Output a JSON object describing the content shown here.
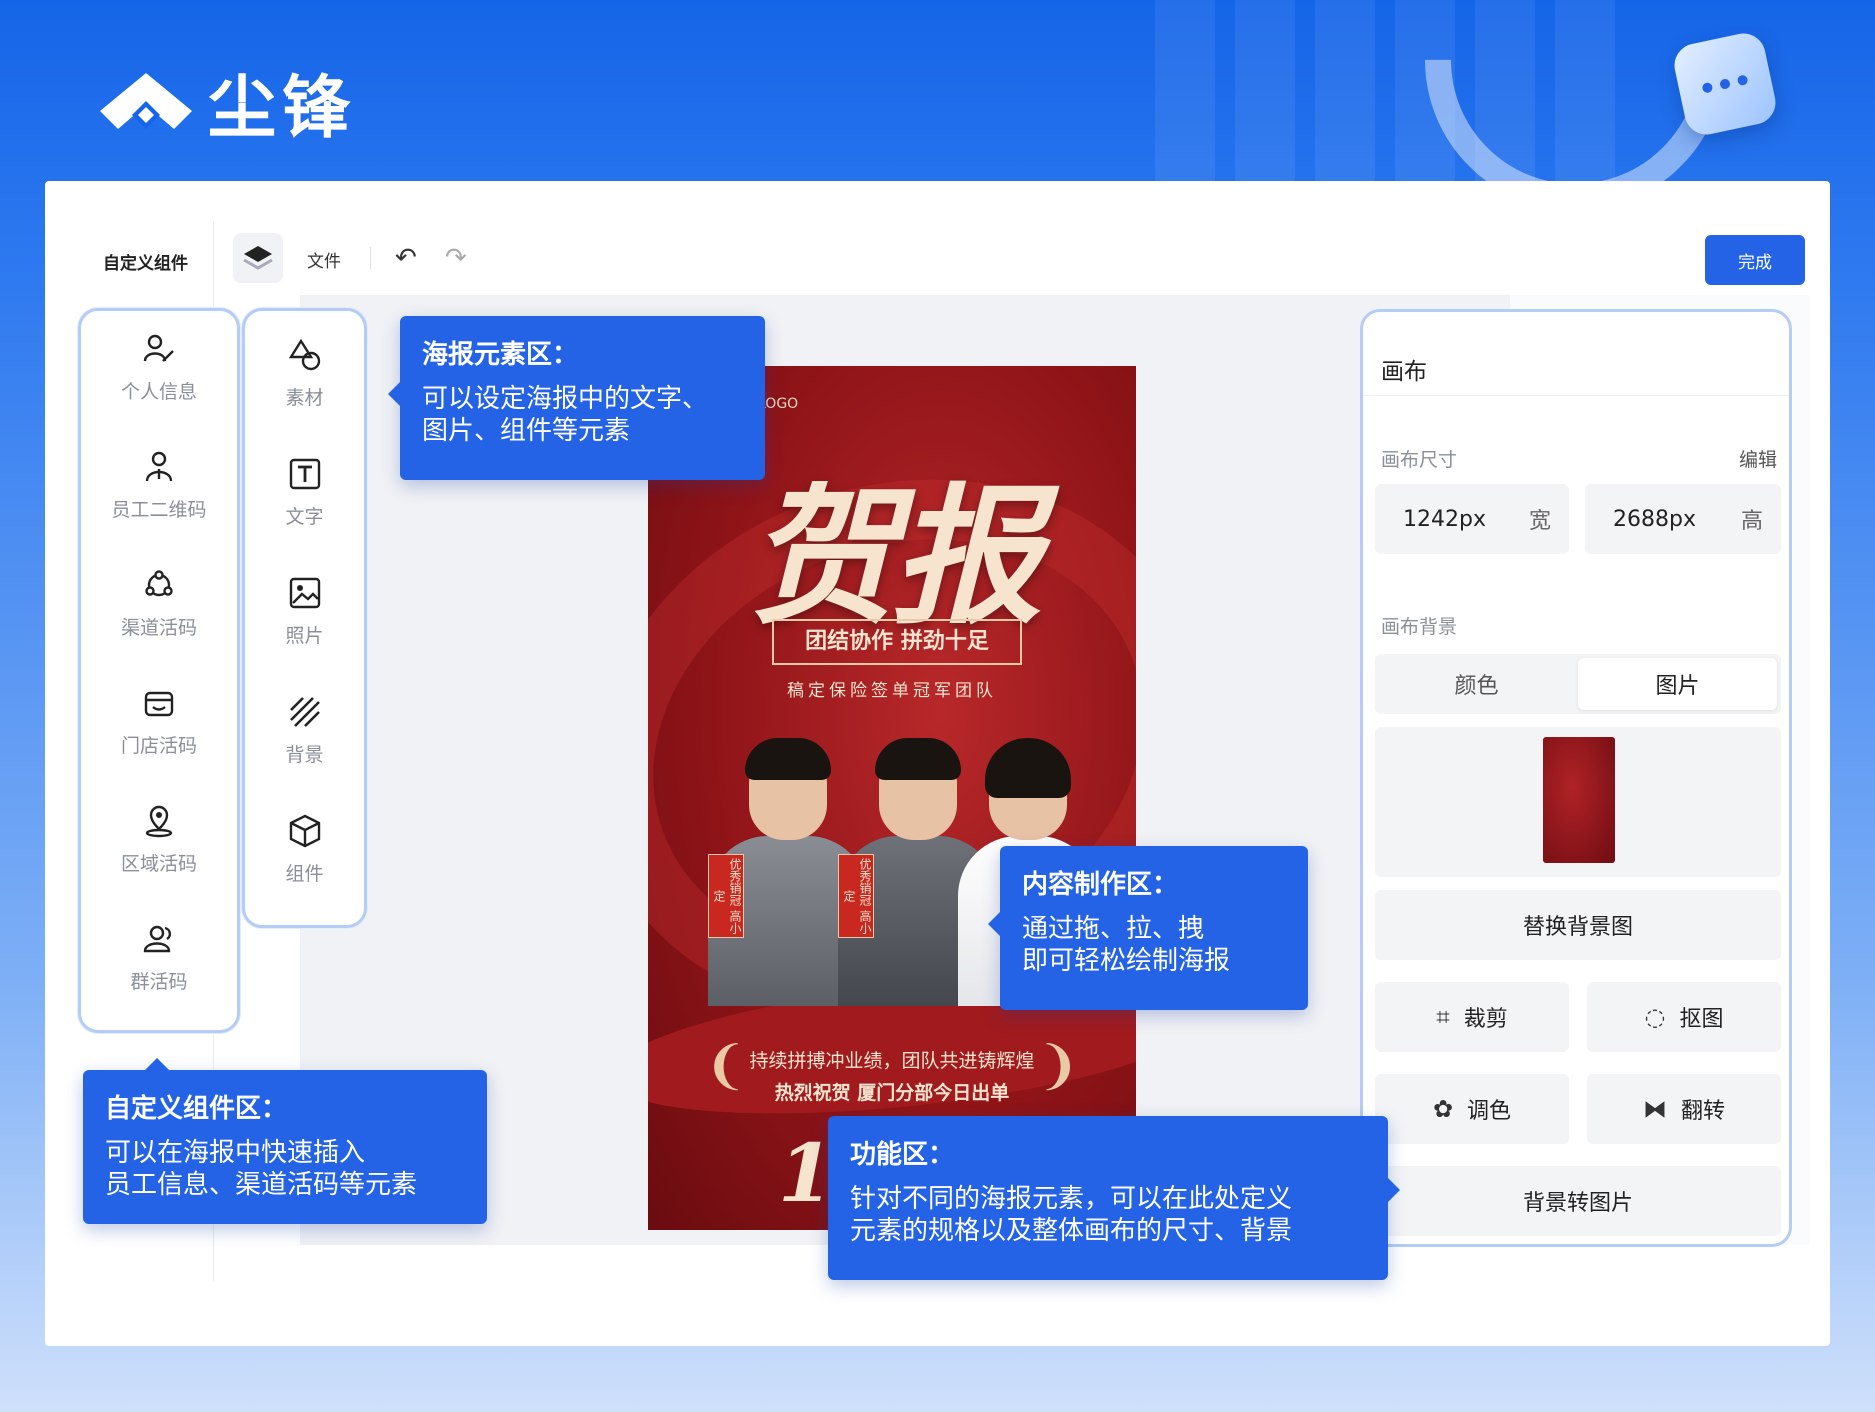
{
  "brand": {
    "name": "尘锋"
  },
  "colors": {
    "accent": "#2463e6",
    "rail_border": "#b3cdf7",
    "poster_red": "#8f1418",
    "poster_gold": "#f6e4cf"
  },
  "toolbar": {
    "left_label": "自定义组件",
    "file_label": "文件",
    "undo_icon": "undo-icon",
    "redo_icon": "redo-icon",
    "done_label": "完成"
  },
  "component_rail": {
    "items": [
      {
        "label": "个人信息",
        "icon": "user-edit-icon"
      },
      {
        "label": "员工二维码",
        "icon": "employee-icon"
      },
      {
        "label": "渠道活码",
        "icon": "channel-icon"
      },
      {
        "label": "门店活码",
        "icon": "store-icon"
      },
      {
        "label": "区域活码",
        "icon": "location-icon"
      },
      {
        "label": "群活码",
        "icon": "group-icon"
      }
    ]
  },
  "element_rail": {
    "items": [
      {
        "label": "素材",
        "icon": "shapes-icon"
      },
      {
        "label": "文字",
        "icon": "text-icon"
      },
      {
        "label": "照片",
        "icon": "image-icon"
      },
      {
        "label": "背景",
        "icon": "background-icon"
      },
      {
        "label": "组件",
        "icon": "cube-icon"
      }
    ]
  },
  "poster": {
    "logo_text": "LOGO",
    "title": "贺报",
    "tag": "团结协作 拼劲十足",
    "subtitle": "稿定保险签单冠军团队",
    "badge1": "优秀销冠 高小定",
    "badge2": "优秀销冠 高小定",
    "slogan1": "持续拼搏冲业绩，团队共进铸辉煌",
    "slogan2": "热烈祝贺 厦门分部今日出单",
    "number": "1"
  },
  "right_panel": {
    "title": "画布",
    "size_label": "画布尺寸",
    "edit_label": "编辑",
    "width_value": "1242px",
    "width_unit": "宽",
    "height_value": "2688px",
    "height_unit": "高",
    "bg_label": "画布背景",
    "tab_color": "颜色",
    "tab_image": "图片",
    "replace_bg": "替换背景图",
    "crop": "裁剪",
    "cutout": "抠图",
    "adjust": "调色",
    "flip": "翻转",
    "bg_to_image": "背景转图片"
  },
  "callouts": {
    "poster_title": "海报元素区：",
    "poster_body1": "可以设定海报中的文字、",
    "poster_body2": "图片、组件等元素",
    "content_title": "内容制作区：",
    "content_body1": "通过拖、拉、拽",
    "content_body2": "即可轻松绘制海报",
    "comp_title": "自定义组件区：",
    "comp_body1": "可以在海报中快速插入",
    "comp_body2": "员工信息、渠道活码等元素",
    "func_title": "功能区：",
    "func_body1": "针对不同的海报元素，可以在此处定义",
    "func_body2": "元素的规格以及整体画布的尺寸、背景"
  }
}
